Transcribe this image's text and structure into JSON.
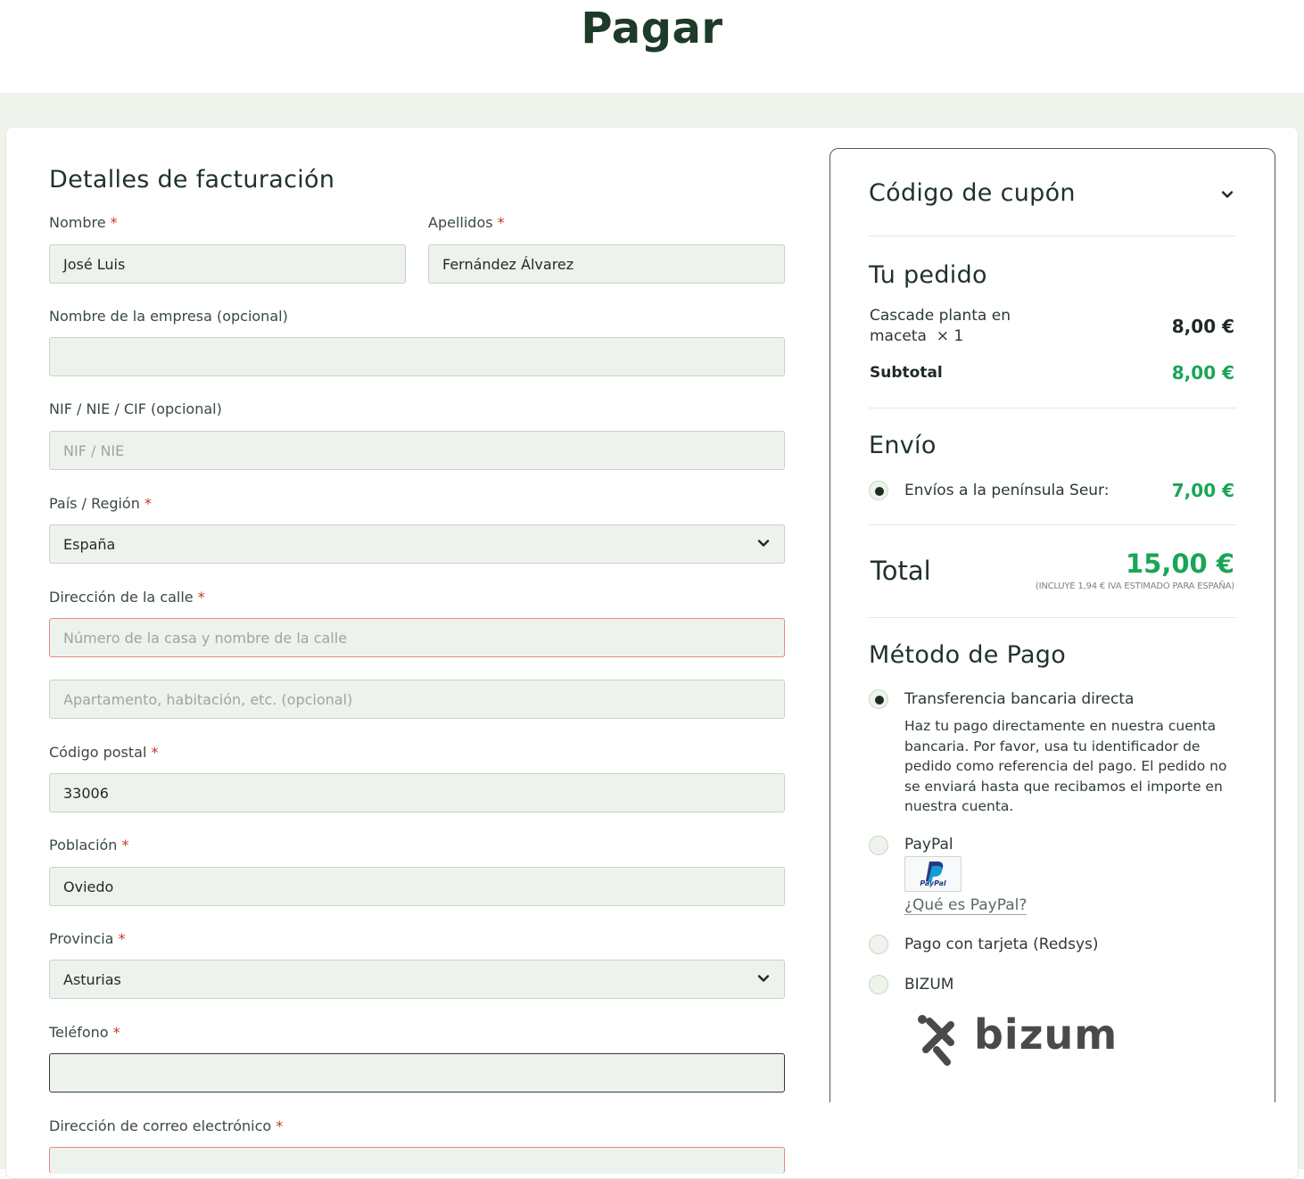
{
  "page": {
    "title": "Pagar"
  },
  "billing": {
    "heading": "Detalles de facturación",
    "required_mark": "*",
    "first_name": {
      "label": "Nombre",
      "value": "José Luis"
    },
    "last_name": {
      "label": "Apellidos",
      "value": "Fernández Álvarez"
    },
    "company": {
      "label": "Nombre de la empresa (opcional)",
      "value": ""
    },
    "tax_id": {
      "label": "NIF / NIE / CIF (opcional)",
      "placeholder": "NIF / NIE"
    },
    "country": {
      "label": "País / Región",
      "value": "España"
    },
    "street": {
      "label": "Dirección de la calle",
      "placeholder": "Número de la casa y nombre de la calle",
      "placeholder2": "Apartamento, habitación, etc. (opcional)"
    },
    "postcode": {
      "label": "Código postal",
      "value": "33006"
    },
    "city": {
      "label": "Población",
      "value": "Oviedo"
    },
    "province": {
      "label": "Provincia",
      "value": "Asturias"
    },
    "phone": {
      "label": "Teléfono",
      "value": ""
    },
    "email": {
      "label": "Dirección de correo electrónico",
      "value": ""
    }
  },
  "order": {
    "coupon_title": "Código de cupón",
    "your_order_title": "Tu pedido",
    "item_name_line1": "Cascade planta en",
    "item_name_line2": "maceta",
    "item_qty": "× 1",
    "item_price": "8,00 €",
    "subtotal_label": "Subtotal",
    "subtotal_value": "8,00 €",
    "shipping_title": "Envío",
    "shipping_option": "Envíos a la península Seur:",
    "shipping_value": "7,00 €",
    "total_label": "Total",
    "total_value": "15,00 €",
    "tax_note": "(INCLUYE 1,94 € IVA ESTIMADO PARA ESPAÑA)"
  },
  "payment": {
    "title": "Método de Pago",
    "bank_label": "Transferencia bancaria directa",
    "bank_desc": [
      "Haz tu pago directamente en nuestra cuenta",
      "bancaria. Por favor, usa tu identificador de",
      "pedido como referencia del pago. El pedido no",
      "se enviará hasta que recibamos el importe en",
      "nuestra cuenta."
    ],
    "paypal_label": "PayPal",
    "paypal_logo_text": "PayPal",
    "paypal_link": "¿Qué es PayPal?",
    "card_label": "Pago con tarjeta (Redsys)",
    "bizum_label": "BIZUM",
    "bizum_logo_text": "bizum"
  }
}
